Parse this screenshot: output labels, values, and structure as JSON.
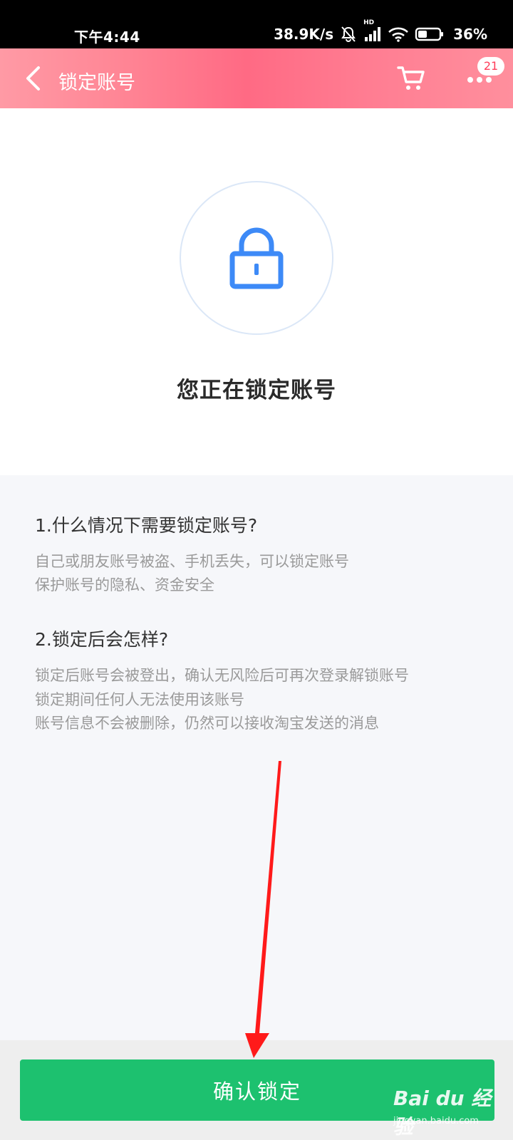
{
  "status_bar": {
    "time": "下午4:44",
    "net_speed": "38.9K/s",
    "hd_label": "HD",
    "battery": "36%",
    "icons": [
      "mute-bell-icon",
      "signal-icon",
      "wifi-icon",
      "battery-icon"
    ]
  },
  "header": {
    "back_icon": "chevron-left-icon",
    "title": "锁定账号",
    "cart_icon": "cart-icon",
    "more_icon": "more-dots-icon",
    "badge": "21"
  },
  "hero": {
    "icon": "lock-icon",
    "title": "您正在锁定账号"
  },
  "info": {
    "sections": [
      {
        "heading": "1.什么情况下需要锁定账号?",
        "lines": [
          "自己或朋友账号被盗、手机丢失，可以锁定账号",
          "保护账号的隐私、资金安全"
        ]
      },
      {
        "heading": "2.锁定后会怎样?",
        "lines": [
          "锁定后账号会被登出，确认无风险后可再次登录解锁账号",
          "锁定期间任何人无法使用该账号",
          "账号信息不会被删除，仍然可以接收淘宝发送的消息"
        ]
      }
    ]
  },
  "footer": {
    "confirm_label": "确认锁定"
  },
  "watermark": {
    "main": "Bai du 经验",
    "sub": "jingyan.baidu.com"
  },
  "colors": {
    "header_gradient": [
      "#ff9aa5",
      "#ff6a84"
    ],
    "lock_blue": "#3d8af7",
    "confirm_green": "#1dc16f",
    "annotation_red": "#ff1a1a"
  }
}
